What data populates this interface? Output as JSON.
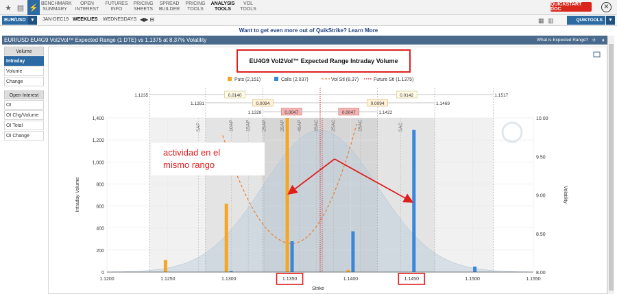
{
  "nav": {
    "items": [
      {
        "label": "BENCHMARK\nSUMMARY",
        "active": false
      },
      {
        "label": "OPEN\nINTEREST",
        "active": false
      },
      {
        "label": "FUTURES\nINFO",
        "active": false
      },
      {
        "label": "PRICING\nSHEETS",
        "active": false
      },
      {
        "label": "SPREAD\nBUILDER",
        "active": false
      },
      {
        "label": "PRICING\nTOOLS",
        "active": false
      },
      {
        "label": "ANALYSIS\nTOOLS",
        "active": true
      },
      {
        "label": "VOL\nTOOLS",
        "active": false
      }
    ],
    "quickstart_label": "QUICKSTART DOC"
  },
  "toolbar": {
    "instrument": "EUR/USD",
    "expiry": "JAN-DEC19",
    "weeklies": "WEEKLIES",
    "wednesdays": "WEDNESDAYS",
    "quicktools": "QUIKTOOLS"
  },
  "promo_text": "Want to get even more out of QuikStrike? Learn More",
  "title_bar": {
    "title": "EUR/USD EU4G9 Vol2Vol™ Expected Range (1 DTE) vs 1.1375 at 8.37% Volatility",
    "help": "What is Expected Range?"
  },
  "sidebar": {
    "volume_header": "Volume",
    "volume_items": [
      "Intraday",
      "Volume",
      "Change"
    ],
    "oi_header": "Open Interest",
    "oi_items": [
      "OI",
      "OI Chg/Volume",
      "OI Total",
      "OI Change"
    ],
    "active_item": "Intraday"
  },
  "chart_data": {
    "type": "bar",
    "title": "EU4G9 Vol2Vol™ Expected Range Intraday Volume",
    "xlabel": "Strike",
    "ylabel": "Intraday Volume",
    "y2label": "Volatility",
    "xlim": [
      1.12,
      1.155
    ],
    "ylim": [
      0,
      1400
    ],
    "y2lim": [
      8.0,
      10.0
    ],
    "x_ticks": [
      "1.1200",
      "1.1250",
      "1.1300",
      "1.1350",
      "1.1400",
      "1.1450",
      "1.1500",
      "1.1550"
    ],
    "y_ticks": [
      "0",
      "200",
      "400",
      "600",
      "800",
      "1,000",
      "1,200",
      "1,400"
    ],
    "y2_ticks": [
      "8.00",
      "8.50",
      "9.00",
      "9.50",
      "10.00"
    ],
    "legend": [
      {
        "label": "Puts (2,151)",
        "color": "#f5a623",
        "kind": "box"
      },
      {
        "label": "Calls (2,037)",
        "color": "#3a86d8",
        "kind": "box"
      },
      {
        "label": "Vol Stl (8.37)",
        "color": "#ef7d2e",
        "kind": "dash"
      },
      {
        "label": "Future Stl (1.1375)",
        "color": "#d0222b",
        "kind": "dotted"
      }
    ],
    "series": [
      {
        "name": "Puts",
        "color": "#f5a623",
        "points": [
          [
            1.125,
            110
          ],
          [
            1.13,
            620
          ],
          [
            1.135,
            1400
          ],
          [
            1.14,
            20
          ]
        ]
      },
      {
        "name": "Calls",
        "color": "#3a86d8",
        "points": [
          [
            1.13,
            10
          ],
          [
            1.135,
            280
          ],
          [
            1.14,
            370
          ],
          [
            1.145,
            1290
          ],
          [
            1.15,
            50
          ]
        ]
      }
    ],
    "future_settle": 1.1375,
    "vol_settle": 8.37,
    "range_bands": [
      {
        "low": 1.1235,
        "high": 1.1517,
        "width_label": "0.0140",
        "width_label_right": "0.0142",
        "low_label": "1.1235",
        "high_label": "1.1517"
      },
      {
        "low": 1.1281,
        "high": 1.1469,
        "width_label": "0.0094",
        "width_label_right": "0.0094",
        "low_label": "1.1281",
        "high_label": "1.1469"
      },
      {
        "low": 1.1328,
        "high": 1.1422,
        "width_label": "0.0047",
        "width_label_right": "0.0047",
        "low_label": "1.1328",
        "high_label": "1.1422"
      }
    ],
    "delta_labels": [
      {
        "x": 1.1275,
        "text": "5AP"
      },
      {
        "x": 1.1302,
        "text": "10AP"
      },
      {
        "x": 1.1316,
        "text": "15AP"
      },
      {
        "x": 1.1329,
        "text": "25AP"
      },
      {
        "x": 1.1344,
        "text": "35AP"
      },
      {
        "x": 1.1358,
        "text": "45AP"
      },
      {
        "x": 1.1372,
        "text": "35AC"
      },
      {
        "x": 1.1386,
        "text": "25AC"
      },
      {
        "x": 1.1408,
        "text": "15AC"
      },
      {
        "x": 1.1441,
        "text": "5AC"
      }
    ],
    "highlighted_ticks": [
      "1.1350",
      "1.1450"
    ]
  },
  "annotation": {
    "text_line1": "actividad en el",
    "text_line2": "mismo rango"
  }
}
